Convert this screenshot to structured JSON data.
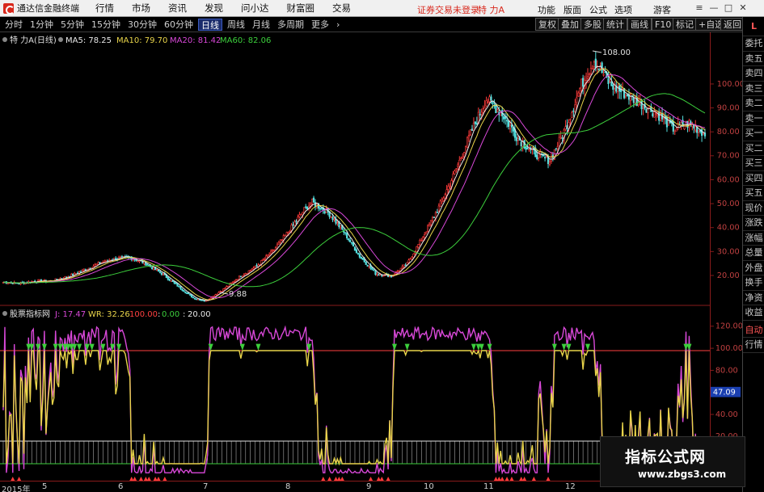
{
  "menubar": {
    "app_title": "通达信金融终端",
    "menu_items": [
      "行情",
      "市场",
      "资讯",
      "发现",
      "问小达",
      "财富圈",
      "交易"
    ],
    "login_warning": "证券交易未登录",
    "stock_name": "特 力A",
    "right_items": [
      "功能",
      "版面",
      "公式",
      "选项"
    ],
    "guest_label": "游客"
  },
  "toolbar": {
    "periods": [
      "分时",
      "1分钟",
      "5分钟",
      "15分钟",
      "30分钟",
      "60分钟",
      "日线",
      "周线",
      "月线",
      "多周期",
      "更多"
    ],
    "active_period": "日线",
    "right_buttons": [
      "复权",
      "叠加",
      "多股",
      "统计",
      "画线",
      "F10",
      "标记",
      "+自选",
      "返回"
    ]
  },
  "main_chart": {
    "title": "特 力A(日线)",
    "ma_labels": [
      {
        "text": "MA5: 78.25",
        "color": "#e8e8e8"
      },
      {
        "text": "MA10: 79.70",
        "color": "#e8d44a"
      },
      {
        "text": "MA20: 81.42",
        "color": "#d848d8"
      },
      {
        "text": "MA60: 82.06",
        "color": "#3ccf3c"
      }
    ],
    "high_label": "108.00",
    "low_label": "9.88"
  },
  "indicator": {
    "title": "股票指标网",
    "values": [
      {
        "text": "J: 17.47",
        "color": "#d848d8"
      },
      {
        "text": "WR: 32.26",
        "color": "#e8d44a"
      },
      {
        "text": "100.00",
        "color": "#ff4040"
      },
      {
        "text": "0.00",
        "color": "#3ccf3c"
      },
      {
        "text": "20.00",
        "color": "#e8e8e8"
      }
    ],
    "current_value": "47.09"
  },
  "side_panel": {
    "top_icon": "L",
    "items": [
      "委托",
      "卖五",
      "卖四",
      "卖三",
      "卖二",
      "卖一",
      "买一",
      "买二",
      "买三",
      "买四",
      "买五",
      "现价",
      "涨跌",
      "涨幅",
      "总量",
      "外盘",
      "换手",
      "净资",
      "收益"
    ],
    "bottom_items": [
      "自动",
      "行情"
    ]
  },
  "date_axis": {
    "labels": [
      "2015年",
      "5",
      "6",
      "7",
      "8",
      "9",
      "10",
      "11",
      "12"
    ]
  },
  "watermark": {
    "title": "指标公式网",
    "url": "www.zbgs3.com"
  },
  "chart_data": [
    {
      "type": "candlestick",
      "title": "特 力A(日线)",
      "ylim": [
        9,
        112
      ],
      "yticks": [
        20,
        30,
        40,
        50,
        60,
        70,
        80,
        90,
        100
      ],
      "ytick_labels": [
        "20.00",
        "30.00",
        "40.00",
        "50.00",
        "60.00",
        "70.00",
        "80.00",
        "90.00",
        "100.00"
      ],
      "price_path": [
        [
          0,
          17.5
        ],
        [
          10,
          17
        ],
        [
          20,
          17.8
        ],
        [
          30,
          18
        ],
        [
          40,
          19.5
        ],
        [
          50,
          22
        ],
        [
          60,
          25
        ],
        [
          70,
          27
        ],
        [
          80,
          27.5
        ],
        [
          90,
          25
        ],
        [
          100,
          21
        ],
        [
          110,
          16
        ],
        [
          120,
          11
        ],
        [
          128,
          9.88
        ],
        [
          140,
          15
        ],
        [
          150,
          20
        ],
        [
          160,
          24
        ],
        [
          170,
          30
        ],
        [
          180,
          38
        ],
        [
          190,
          47
        ],
        [
          195,
          50
        ],
        [
          205,
          46
        ],
        [
          215,
          38
        ],
        [
          225,
          28
        ],
        [
          235,
          21
        ],
        [
          245,
          20
        ],
        [
          255,
          25
        ],
        [
          265,
          36
        ],
        [
          275,
          48
        ],
        [
          285,
          62
        ],
        [
          295,
          78
        ],
        [
          305,
          92
        ],
        [
          315,
          86
        ],
        [
          325,
          76
        ],
        [
          335,
          70
        ],
        [
          345,
          67
        ],
        [
          355,
          80
        ],
        [
          365,
          98
        ],
        [
          373,
          108
        ],
        [
          383,
          98
        ],
        [
          393,
          94
        ],
        [
          403,
          90
        ],
        [
          413,
          86
        ],
        [
          423,
          80
        ],
        [
          433,
          82
        ],
        [
          443,
          78
        ]
      ],
      "series": [
        {
          "name": "MA5",
          "color": "#e8e8e8",
          "last": 78.25
        },
        {
          "name": "MA10",
          "color": "#e8d44a",
          "last": 79.7
        },
        {
          "name": "MA20",
          "color": "#d848d8",
          "last": 81.42
        },
        {
          "name": "MA60",
          "color": "#3ccf3c",
          "last": 82.06
        }
      ],
      "annotations": [
        {
          "text": "108.00",
          "y": 108
        },
        {
          "text": "9.88",
          "y": 9.88
        }
      ]
    },
    {
      "type": "line",
      "title": "股票指标网",
      "ylim": [
        -10,
        135
      ],
      "yticks": [
        20,
        40,
        60,
        80,
        100,
        120
      ],
      "ytick_labels": [
        "20.00",
        "40.00",
        "60.00",
        "80.00",
        "100.00",
        "120.00"
      ],
      "reference_lines": [
        100,
        0,
        20
      ],
      "series": [
        {
          "name": "J",
          "color": "#d848d8",
          "last": 17.47
        },
        {
          "name": "WR",
          "color": "#e8d44a",
          "last": 32.26
        }
      ],
      "current_value": 47.09
    }
  ]
}
